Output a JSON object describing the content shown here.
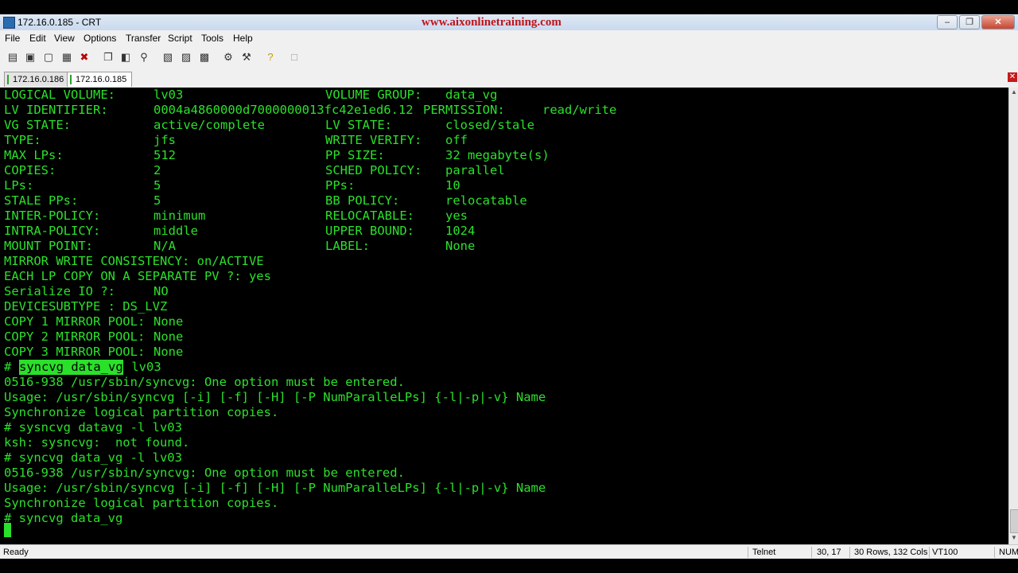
{
  "window": {
    "title": "172.16.0.185 - CRT",
    "site": "www.aixonlinetraining.com"
  },
  "menu": [
    "File",
    "Edit",
    "View",
    "Options",
    "Transfer",
    "Script",
    "Tools",
    "Help"
  ],
  "toolbar_icons": [
    "connect-icon",
    "quick-connect-icon",
    "connect-in-tab-icon",
    "reconnect-icon",
    "disconnect-icon",
    "copy-icon",
    "paste-icon",
    "find-icon",
    "print-icon",
    "print-selection-icon",
    "print-screen-icon",
    "session-options-icon",
    "global-options-icon",
    "help-icon",
    "keymap-icon"
  ],
  "tabs": [
    {
      "label": "172.16.0.186",
      "active": false
    },
    {
      "label": "172.16.0.185",
      "active": true
    }
  ],
  "terminal": {
    "color": "#2be02b",
    "lines": [
      {
        "left": "LOGICAL VOLUME:",
        "lval": "lv03",
        "right": "VOLUME GROUP:",
        "rval": "data_vg"
      },
      {
        "left": "LV IDENTIFIER:",
        "lval": "0004a4860000d7000000013fc42e1ed6.12",
        "right": "PERMISSION:",
        "rval": "read/write"
      },
      {
        "left": "VG STATE:",
        "lval": "active/complete",
        "right": "LV STATE:",
        "rval": "closed/stale"
      },
      {
        "left": "TYPE:",
        "lval": "jfs",
        "right": "WRITE VERIFY:",
        "rval": "off"
      },
      {
        "left": "MAX LPs:",
        "lval": "512",
        "right": "PP SIZE:",
        "rval": "32 megabyte(s)"
      },
      {
        "left": "COPIES:",
        "lval": "2",
        "right": "SCHED POLICY:",
        "rval": "parallel"
      },
      {
        "left": "LPs:",
        "lval": "5",
        "right": "PPs:",
        "rval": "10"
      },
      {
        "left": "STALE PPs:",
        "lval": "5",
        "right": "BB POLICY:",
        "rval": "relocatable"
      },
      {
        "left": "INTER-POLICY:",
        "lval": "minimum",
        "right": "RELOCATABLE:",
        "rval": "yes"
      },
      {
        "left": "INTRA-POLICY:",
        "lval": "middle",
        "right": "UPPER BOUND:",
        "rval": "1024"
      },
      {
        "left": "MOUNT POINT:",
        "lval": "N/A",
        "right": "LABEL:",
        "rval": "None"
      },
      {
        "text": "MIRROR WRITE CONSISTENCY: on/ACTIVE"
      },
      {
        "text": "EACH LP COPY ON A SEPARATE PV ?: yes"
      },
      {
        "left": "Serialize IO ?:",
        "lval": "NO"
      },
      {
        "text": "DEVICESUBTYPE : DS_LVZ"
      },
      {
        "left": "COPY 1 MIRROR POOL:",
        "lval": "None"
      },
      {
        "left": "COPY 2 MIRROR POOL:",
        "lval": "None"
      },
      {
        "left": "COPY 3 MIRROR POOL:",
        "lval": "None"
      },
      {
        "prompt": "# ",
        "hl": "syncvg data_vg",
        "rest": " lv03"
      },
      {
        "text": "0516-938 /usr/sbin/syncvg: One option must be entered."
      },
      {
        "text": "Usage: /usr/sbin/syncvg [-i] [-f] [-H] [-P NumParalleLPs] {-l|-p|-v} Name"
      },
      {
        "text": "Synchronize logical partition copies."
      },
      {
        "text": "# sysncvg datavg -l lv03"
      },
      {
        "text": "ksh: sysncvg:  not found."
      },
      {
        "text": "# syncvg data_vg -l lv03"
      },
      {
        "text": "0516-938 /usr/sbin/syncvg: One option must be entered."
      },
      {
        "text": "Usage: /usr/sbin/syncvg [-i] [-f] [-H] [-P NumParalleLPs] {-l|-p|-v} Name"
      },
      {
        "text": "Synchronize logical partition copies."
      },
      {
        "text": "# syncvg data_vg"
      }
    ]
  },
  "status": {
    "ready": "Ready",
    "protocol": "Telnet",
    "cursor": "30, 17",
    "size": "30 Rows, 132 Cols",
    "emulation": "VT100",
    "num": "NUM"
  }
}
